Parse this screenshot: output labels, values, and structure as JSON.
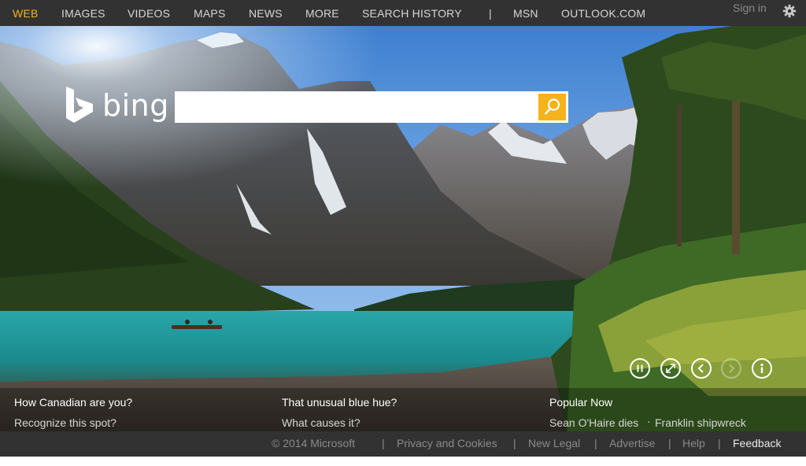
{
  "nav": {
    "items": [
      "WEB",
      "IMAGES",
      "VIDEOS",
      "MAPS",
      "NEWS",
      "MORE",
      "SEARCH HISTORY"
    ],
    "separator": "|",
    "msn": "MSN",
    "outlook": "OUTLOOK.COM",
    "sign_in": "Sign in",
    "settings_icon": "gear-icon",
    "active_color": "#f5b21a"
  },
  "logo": {
    "text": "bing"
  },
  "search": {
    "value": "",
    "button_icon": "search-icon",
    "button_color": "#f5b21a"
  },
  "controls": [
    "pause-icon",
    "fullscreen-icon",
    "previous-icon",
    "next-icon",
    "info-icon"
  ],
  "hotspots": [
    {
      "title": "How Canadian are you?",
      "subtitle": "Recognize this spot?"
    },
    {
      "title": "That unusual blue hue?",
      "subtitle": "What causes it?"
    }
  ],
  "popular": {
    "title": "Popular Now",
    "items": [
      "Sean O'Haire dies",
      "Franklin shipwreck"
    ],
    "separator": "·"
  },
  "footer": {
    "copyright": "© 2014 Microsoft",
    "separator": "|",
    "links": [
      "Privacy and Cookies",
      "New Legal",
      "Advertise",
      "Help"
    ],
    "feedback": "Feedback"
  }
}
